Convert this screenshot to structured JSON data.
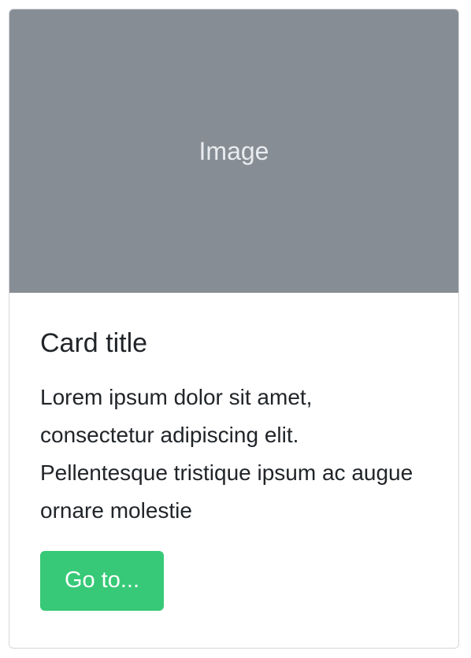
{
  "card": {
    "image_placeholder_label": "Image",
    "title": "Card title",
    "text": "Lorem ipsum dolor sit amet, consectetur adipiscing elit. Pellentesque tristique ipsum ac augue ornare molestie",
    "button_label": "Go to..."
  },
  "colors": {
    "image_background": "#878d94",
    "button_background": "#37c977",
    "text": "#212529"
  }
}
